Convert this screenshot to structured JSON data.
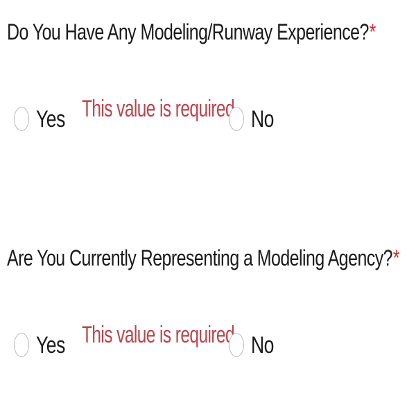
{
  "questions": [
    {
      "label": "Do You Have Any Modeling/Runway Experience?",
      "required_marker": "*",
      "options": [
        "Yes",
        "No"
      ],
      "error": "This value is required."
    },
    {
      "label": "Are You Currently Representing a Modeling Agency?",
      "required_marker": "*",
      "options": [
        "Yes",
        "No"
      ],
      "error": "This value is required."
    }
  ],
  "colors": {
    "text": "#1a1a1a",
    "error": "#b8454d",
    "required": "#cc3333",
    "radio_border": "#b9b9b9"
  }
}
